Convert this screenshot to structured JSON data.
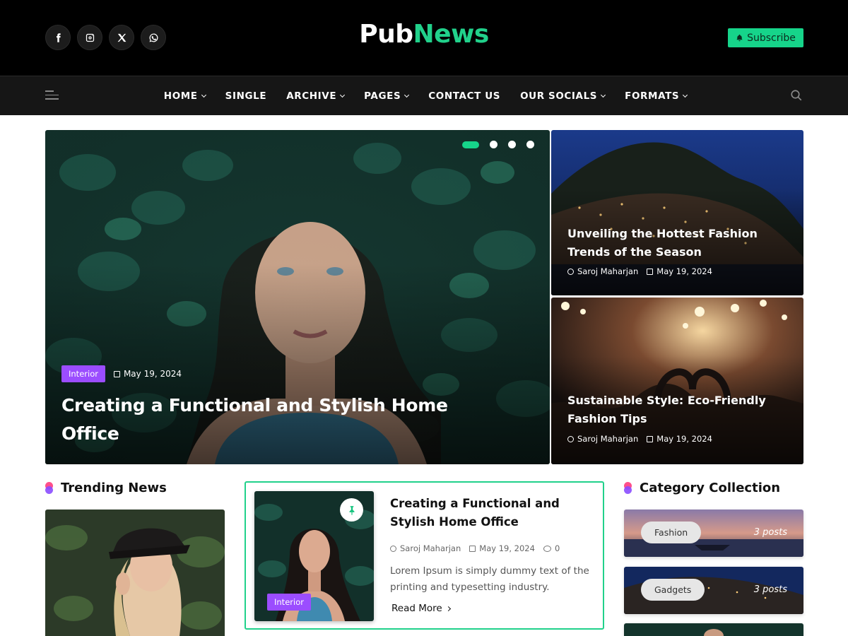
{
  "header": {
    "logo_part1": "Pub",
    "logo_part2": "News",
    "subscribe_label": "Subscribe",
    "social_icons": [
      "facebook-icon",
      "instagram-icon",
      "x-icon",
      "whatsapp-icon"
    ]
  },
  "nav": {
    "items": [
      {
        "label": "HOME",
        "dropdown": true
      },
      {
        "label": "SINGLE",
        "dropdown": false
      },
      {
        "label": "ARCHIVE",
        "dropdown": true
      },
      {
        "label": "PAGES",
        "dropdown": true
      },
      {
        "label": "CONTACT US",
        "dropdown": false
      },
      {
        "label": "OUR SOCIALS",
        "dropdown": true
      },
      {
        "label": "FORMATS",
        "dropdown": true
      }
    ]
  },
  "hero": {
    "main": {
      "tag": "Interior",
      "date": "May 19, 2024",
      "title": "Creating a Functional and Stylish Home Office",
      "slides": 4,
      "active_slide": 1
    },
    "side": [
      {
        "title": "Unveiling the Hottest Fashion Trends of the Season",
        "author": "Saroj Maharjan",
        "date": "May 19, 2024"
      },
      {
        "title": "Sustainable Style: Eco-Friendly Fashion Tips",
        "author": "Saroj Maharjan",
        "date": "May 19, 2024"
      }
    ]
  },
  "trending": {
    "heading": "Trending News"
  },
  "featured": {
    "title": "Creating a Functional and Stylish Home Office",
    "author": "Saroj Maharjan",
    "date": "May 19, 2024",
    "comments": "0",
    "excerpt": "Lorem Ipsum is simply dummy text of the printing and typesetting industry.",
    "read_more": "Read More",
    "tag": "Interior"
  },
  "categories": {
    "heading": "Category Collection",
    "items": [
      {
        "name": "Fashion",
        "count": "3 posts"
      },
      {
        "name": "Gadgets",
        "count": "3 posts"
      }
    ]
  },
  "colors": {
    "accent": "#16d48a",
    "tag": "#9b4dff",
    "header_bg": "#000000",
    "nav_bg": "#161616"
  }
}
